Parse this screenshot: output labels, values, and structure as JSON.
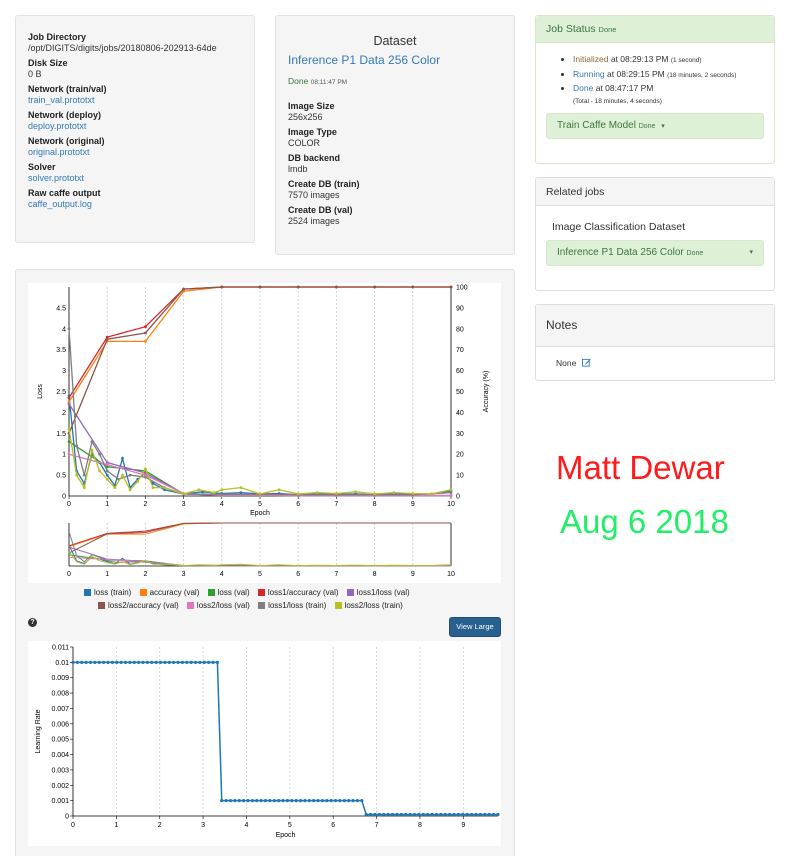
{
  "job_info": {
    "job_directory_label": "Job Directory",
    "job_directory": "/opt/DIGITS/digits/jobs/20180806-202913-64de",
    "disk_size_label": "Disk Size",
    "disk_size": "0 B",
    "network_train_val_label": "Network (train/val)",
    "network_train_val": "train_val.prototxt",
    "network_deploy_label": "Network (deploy)",
    "network_deploy": "deploy.prototxt",
    "network_original_label": "Network (original)",
    "network_original": "original.prototxt",
    "solver_label": "Solver",
    "solver": "solver.prototxt",
    "raw_output_label": "Raw caffe output",
    "raw_output": "caffe_output.log"
  },
  "dataset": {
    "title": "Dataset",
    "name": "Inference P1 Data 256 Color",
    "status": "Done",
    "status_time": "08:11:47 PM",
    "image_size_label": "Image Size",
    "image_size": "256x256",
    "image_type_label": "Image Type",
    "image_type": "COLOR",
    "backend_label": "DB backend",
    "backend": "lmdb",
    "create_train_label": "Create DB (train)",
    "create_train": "7570 images",
    "create_val_label": "Create DB (val)",
    "create_val": "2524 images"
  },
  "job_status": {
    "title": "Job Status",
    "title_state": "Done",
    "events": [
      {
        "state": "Initialized",
        "at": "at 08:29:13 PM",
        "duration": "(1 second)"
      },
      {
        "state": "Running",
        "at": "at 08:29:15 PM",
        "duration": "(18 minutes, 2 seconds)"
      },
      {
        "state": "Done",
        "at": "at 08:47:17 PM",
        "duration": ""
      }
    ],
    "total": "(Total - 18 minutes, 4 seconds)",
    "task_button": "Train Caffe Model",
    "task_state": "Done"
  },
  "related_jobs": {
    "title": "Related jobs",
    "label": "Image Classification Dataset",
    "button": "Inference P1 Data 256 Color",
    "button_state": "Done"
  },
  "notes": {
    "title": "Notes",
    "value": "None"
  },
  "signature": {
    "name": "Matt Dewar",
    "date": "Aug 6 2018"
  },
  "view_large_button": "View Large",
  "help_icon": "?",
  "colors": {
    "loss_train": "#1f77b4",
    "accuracy_val": "#ff7f0e",
    "loss_val": "#2ca02c",
    "loss1_accuracy_val": "#d62728",
    "loss1_loss_val": "#9467bd",
    "loss2_accuracy_val": "#8c564b",
    "loss2_loss_val": "#e377c2",
    "loss1_loss_train": "#7f7f7f",
    "loss2_loss_train": "#bcbd22",
    "success_green": "#3c763d",
    "link_blue": "#337ab7"
  },
  "chart_data": [
    {
      "type": "line",
      "xlabel": "Epoch",
      "ylabel": "Loss",
      "y2label": "Accuracy (%)",
      "xlim": [
        0,
        10
      ],
      "ylim": [
        0,
        5
      ],
      "y2lim": [
        0,
        100
      ],
      "x_ticks": [
        0,
        1,
        2,
        3,
        4,
        5,
        6,
        7,
        8,
        9,
        10
      ],
      "y_ticks": [
        0,
        0.5,
        1,
        1.5,
        2,
        2.5,
        3,
        3.5,
        4,
        4.5
      ],
      "y2_ticks": [
        0,
        10,
        20,
        30,
        40,
        50,
        60,
        70,
        80,
        90,
        100
      ],
      "grid": "vertical dashed",
      "legend": "bottom",
      "series": [
        {
          "name": "loss (train)",
          "axis": "left",
          "color": "#1f77b4",
          "x": [
            0,
            0.2,
            0.4,
            0.6,
            0.8,
            1.0,
            1.2,
            1.4,
            1.6,
            1.8,
            2.0,
            2.2,
            2.5,
            3.0,
            3.5,
            4.0,
            4.5,
            5.0,
            5.5,
            6.0,
            6.5,
            7.0,
            7.5,
            8.0,
            8.5,
            9.0,
            9.5,
            10.0
          ],
          "y": [
            2.4,
            0.6,
            0.3,
            1.0,
            0.8,
            0.5,
            0.25,
            0.9,
            0.2,
            0.4,
            0.55,
            0.3,
            0.15,
            0.05,
            0.1,
            0.06,
            0.08,
            0.05,
            0.06,
            0.03,
            0.05,
            0.04,
            0.05,
            0.03,
            0.05,
            0.04,
            0.05,
            0.12
          ]
        },
        {
          "name": "accuracy (val)",
          "axis": "right",
          "color": "#ff7f0e",
          "x": [
            0,
            1,
            2,
            3,
            4,
            5,
            6,
            7,
            8,
            9,
            10
          ],
          "y": [
            45,
            74,
            74,
            98,
            100,
            100,
            100,
            100,
            100,
            100,
            100
          ]
        },
        {
          "name": "loss (val)",
          "axis": "left",
          "color": "#2ca02c",
          "x": [
            0,
            1,
            2,
            3,
            4,
            5,
            6,
            7,
            8,
            9,
            10
          ],
          "y": [
            1.3,
            0.7,
            0.6,
            0.05,
            0.02,
            0.02,
            0.01,
            0.01,
            0.01,
            0.01,
            0.01
          ]
        },
        {
          "name": "loss1/accuracy (val)",
          "axis": "right",
          "color": "#d62728",
          "x": [
            0,
            1,
            2,
            3,
            4,
            5,
            6,
            7,
            8,
            9,
            10
          ],
          "y": [
            47,
            76,
            81,
            99,
            100,
            100,
            100,
            100,
            100,
            100,
            100
          ]
        },
        {
          "name": "loss1/loss (val)",
          "axis": "left",
          "color": "#9467bd",
          "x": [
            0,
            1,
            2,
            3,
            4,
            5,
            6,
            7,
            8,
            9,
            10
          ],
          "y": [
            2.2,
            0.8,
            0.55,
            0.05,
            0.02,
            0.02,
            0.01,
            0.01,
            0.01,
            0.01,
            0.01
          ]
        },
        {
          "name": "loss2/accuracy (val)",
          "axis": "right",
          "color": "#8c564b",
          "x": [
            0,
            1,
            2,
            3,
            4,
            5,
            6,
            7,
            8,
            9,
            10
          ],
          "y": [
            30,
            75,
            78,
            99,
            100,
            100,
            100,
            100,
            100,
            100,
            100
          ]
        },
        {
          "name": "loss2/loss (val)",
          "axis": "left",
          "color": "#e377c2",
          "x": [
            0,
            1,
            2,
            3,
            4,
            5,
            6,
            7,
            8,
            9,
            10
          ],
          "y": [
            1.0,
            0.75,
            0.5,
            0.06,
            0.02,
            0.02,
            0.01,
            0.01,
            0.01,
            0.01,
            0.01
          ]
        },
        {
          "name": "loss1/loss (train)",
          "axis": "left",
          "color": "#7f7f7f",
          "x": [
            0,
            0.2,
            0.4,
            0.6,
            0.8,
            1.0,
            1.3,
            1.6,
            2.0,
            2.5,
            3.0,
            4.0,
            5.0,
            6.0,
            7.0,
            8.0,
            9.0,
            10.0
          ],
          "y": [
            4.0,
            1.2,
            0.5,
            1.3,
            1.0,
            0.6,
            0.4,
            0.5,
            0.45,
            0.2,
            0.05,
            0.04,
            0.04,
            0.03,
            0.03,
            0.03,
            0.03,
            0.08
          ]
        },
        {
          "name": "loss2/loss (train)",
          "axis": "left",
          "color": "#bcbd22",
          "x": [
            0,
            0.2,
            0.4,
            0.6,
            0.8,
            1.0,
            1.2,
            1.4,
            1.6,
            1.8,
            2.0,
            2.2,
            2.5,
            3.0,
            3.4,
            3.8,
            4.0,
            4.5,
            5.0,
            5.5,
            6.0,
            6.5,
            7.0,
            7.5,
            8.0,
            8.5,
            9.0,
            9.5,
            10.0
          ],
          "y": [
            1.6,
            0.5,
            0.2,
            1.1,
            0.6,
            0.4,
            0.2,
            0.5,
            0.15,
            0.35,
            0.65,
            0.2,
            0.2,
            0.05,
            0.15,
            0.08,
            0.15,
            0.2,
            0.05,
            0.15,
            0.05,
            0.08,
            0.06,
            0.1,
            0.05,
            0.08,
            0.06,
            0.05,
            0.15
          ]
        }
      ]
    },
    {
      "type": "line",
      "xlabel": "Epoch",
      "ylabel": "Learning Rate",
      "xlim": [
        0,
        9.8
      ],
      "ylim": [
        0,
        0.011
      ],
      "x_ticks": [
        0,
        1,
        2,
        3,
        4,
        5,
        6,
        7,
        8,
        9
      ],
      "y_ticks": [
        0,
        0.001,
        0.002,
        0.003,
        0.004,
        0.005,
        0.006,
        0.007,
        0.008,
        0.009,
        0.01,
        0.011
      ],
      "grid": "vertical dashed",
      "series": [
        {
          "name": "",
          "color": "#1f77b4",
          "x": [
            0,
            3.33,
            3.43,
            6.66,
            6.76,
            9.8
          ],
          "y": [
            0.01,
            0.01,
            0.001,
            0.001,
            0.0001,
            0.0001
          ]
        }
      ]
    }
  ]
}
